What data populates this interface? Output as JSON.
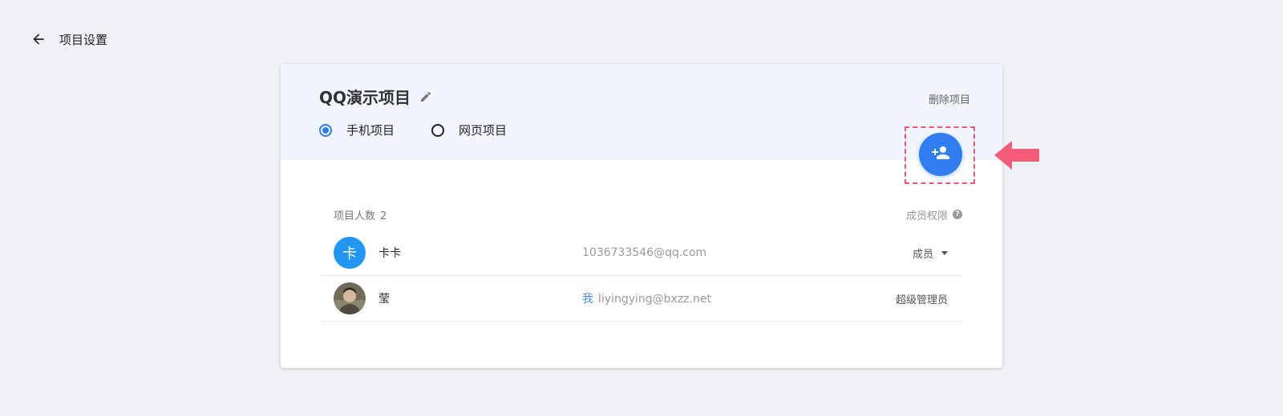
{
  "header": {
    "back_icon": "arrow-left-icon",
    "title": "项目设置"
  },
  "project": {
    "name": "QQ演示项目",
    "edit_icon": "pencil-icon",
    "delete_label": "删除项目",
    "types": [
      {
        "label": "手机项目",
        "selected": true
      },
      {
        "label": "网页项目",
        "selected": false
      }
    ]
  },
  "add_member": {
    "icon": "person-add-icon",
    "accent": "#2f7df0",
    "highlight_color": "#f05473"
  },
  "members": {
    "count_label": "项目人数",
    "count": "2",
    "permission_label": "成员权限",
    "help_icon": "question-circle-icon",
    "help_glyph": "?",
    "rows": [
      {
        "avatar_text": "卡",
        "name": "卡卡",
        "me_tag": "",
        "email": "1036733546@qq.com",
        "role": "成员"
      },
      {
        "avatar_text": "",
        "name": "莹",
        "me_tag": "我",
        "email": "liyingying@bxzz.net",
        "role": "超级管理员"
      }
    ]
  }
}
